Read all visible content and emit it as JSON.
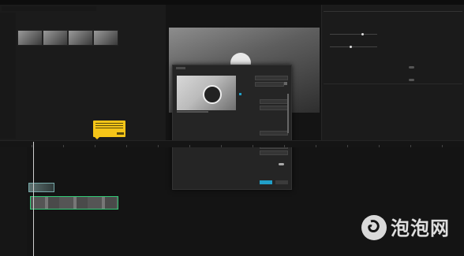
{
  "watermark": {
    "text": "泡泡网"
  },
  "colors": {
    "accent": "#21a0c9",
    "tooltip": "#f5c518",
    "track_main": "#3c7"
  },
  "icons": [
    "play-icon",
    "bubble-logo-icon"
  ]
}
